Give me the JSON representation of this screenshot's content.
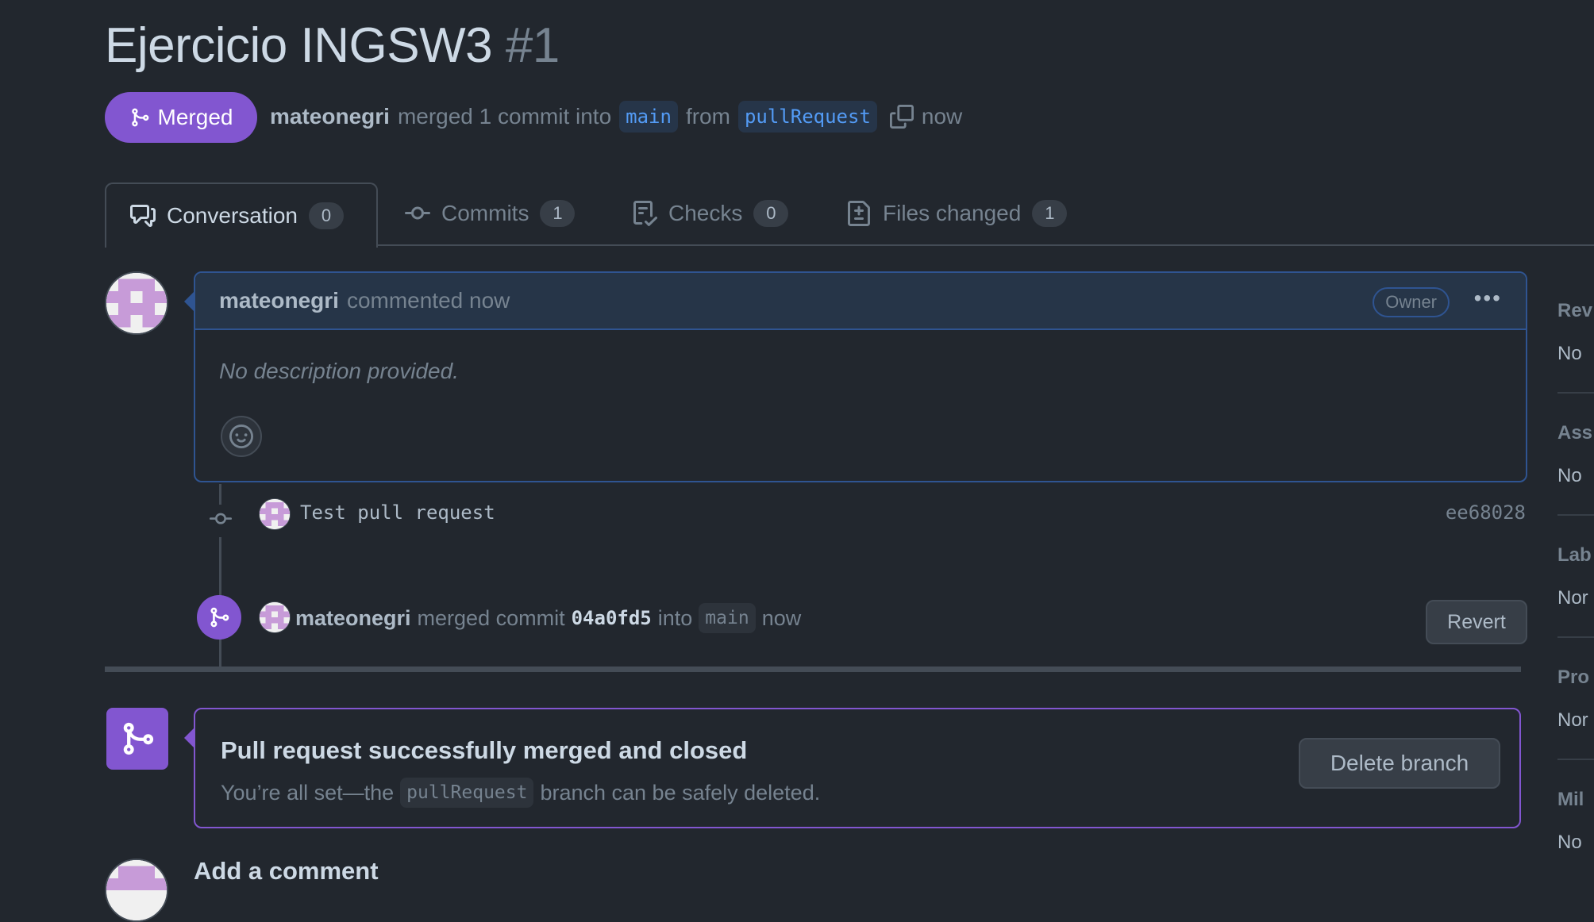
{
  "header": {
    "title": "Ejercicio INGSW3",
    "number": "#1",
    "state": "Merged",
    "author": "mateonegri",
    "merge_text": "merged 1 commit into",
    "base_branch": "main",
    "from_text": "from",
    "head_branch": "pullRequest",
    "time": "now"
  },
  "tabs": [
    {
      "label": "Conversation",
      "count": "0"
    },
    {
      "label": "Commits",
      "count": "1"
    },
    {
      "label": "Checks",
      "count": "0"
    },
    {
      "label": "Files changed",
      "count": "1"
    }
  ],
  "comment": {
    "author": "mateonegri",
    "action": "commented now",
    "role": "Owner",
    "body": "No description provided."
  },
  "commit": {
    "message": "Test pull request",
    "sha": "ee68028"
  },
  "merge_event": {
    "author": "mateonegri",
    "text": "merged commit",
    "sha": "04a0fd5",
    "into": "into",
    "branch": "main",
    "time": "now",
    "revert_label": "Revert"
  },
  "merge_box": {
    "title": "Pull request successfully merged and closed",
    "sub_before": "You’re all set—the",
    "branch": "pullRequest",
    "sub_after": "branch can be safely deleted.",
    "delete_label": "Delete branch"
  },
  "add_comment": "Add a comment",
  "sidebar": [
    {
      "heading": "Rev",
      "value": "No"
    },
    {
      "heading": "Ass",
      "value": "No"
    },
    {
      "heading": "Lab",
      "value": "Nor"
    },
    {
      "heading": "Pro",
      "value": "Nor"
    },
    {
      "heading": "Mil",
      "value": "No"
    }
  ],
  "colors": {
    "background": "#22272e",
    "merged_purple": "#8256d0",
    "link_blue": "#539bf5",
    "comment_border": "#2f5491"
  },
  "icons": [
    "git-merge-icon",
    "copy-icon",
    "conversation-icon",
    "git-commit-icon",
    "checklist-icon",
    "file-diff-icon",
    "kebab-horizontal-icon",
    "smiley-icon"
  ]
}
